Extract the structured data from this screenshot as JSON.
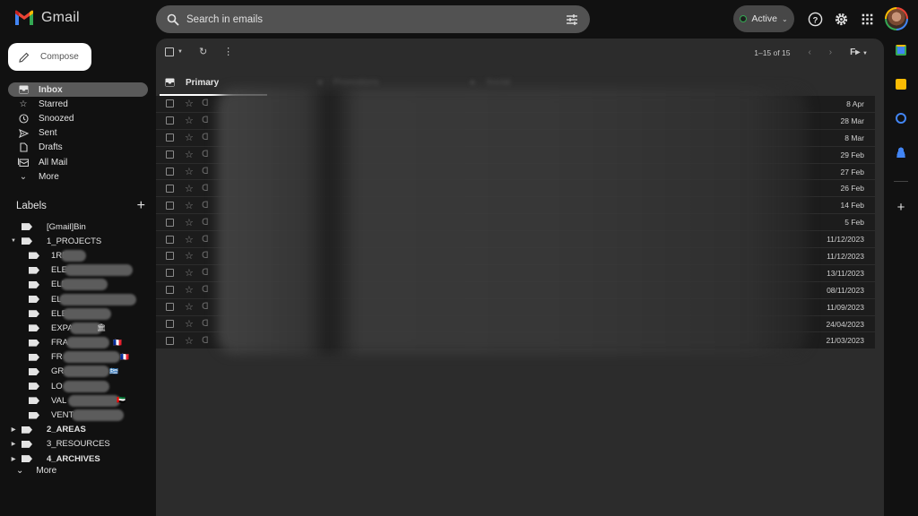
{
  "app": {
    "title": "Gmail",
    "brand_colors": {
      "red": "#ea4335",
      "blue": "#4285f4",
      "green": "#34a853",
      "yellow": "#fbbc04"
    }
  },
  "header": {
    "search_placeholder": "Search in emails",
    "status_label": "Active",
    "status_color": "#34a853",
    "icons": [
      "search-icon",
      "tune-icon",
      "help-icon",
      "settings-icon",
      "apps-grid-icon",
      "account-avatar"
    ]
  },
  "sidebar": {
    "compose_label": "Compose",
    "items": [
      {
        "label": "Inbox",
        "icon": "inbox-icon",
        "active": true
      },
      {
        "label": "Starred",
        "icon": "star-icon"
      },
      {
        "label": "Snoozed",
        "icon": "clock-icon"
      },
      {
        "label": "Sent",
        "icon": "send-icon"
      },
      {
        "label": "Drafts",
        "icon": "draft-icon"
      },
      {
        "label": "All Mail",
        "icon": "all-mail-icon"
      },
      {
        "label": "More",
        "icon": "chevron-down-icon"
      }
    ],
    "labels_title": "Labels",
    "labels": [
      {
        "label": "[Gmail]Bin",
        "level": "top-plain"
      },
      {
        "label": "1_PROJECTS",
        "level": "top",
        "expanded": true
      },
      {
        "label": "1RE",
        "level": "child",
        "redacted": true
      },
      {
        "label": "ELE E",
        "level": "child",
        "redacted": true
      },
      {
        "label": "ELE",
        "level": "child",
        "redacted": true
      },
      {
        "label": "ELE",
        "level": "child",
        "redacted": true
      },
      {
        "label": "ELE",
        "level": "child",
        "redacted": true
      },
      {
        "label": "EXPA",
        "level": "child",
        "redacted": true,
        "emoji": "🏛"
      },
      {
        "label": "FRA",
        "level": "child",
        "redacted": true,
        "emoji": "🇫🇷"
      },
      {
        "label": "FR",
        "level": "child",
        "redacted": true,
        "emoji": "🇫🇷"
      },
      {
        "label": "GR",
        "level": "child",
        "redacted": true,
        "emoji": "🇬🇷"
      },
      {
        "label": "LO",
        "level": "child",
        "redacted": true
      },
      {
        "label": "VAL",
        "level": "child",
        "redacted": true,
        "emoji": "🇦🇪"
      },
      {
        "label": "VENT",
        "level": "child",
        "redacted": true
      },
      {
        "label": "2_AREAS",
        "level": "top",
        "bold": true
      },
      {
        "label": "3_RESOURCES",
        "level": "top"
      },
      {
        "label": "4_ARCHIVES",
        "level": "top",
        "bold": true
      }
    ],
    "more_label": "More"
  },
  "main": {
    "pagination": "1–15 of 15",
    "format_label": "F",
    "tabs": [
      {
        "label": "Primary",
        "active": true
      },
      {
        "label": "Promotions",
        "blurred": true
      },
      {
        "label": "Social",
        "blurred": true
      }
    ],
    "emails": [
      {
        "date": "8 Apr"
      },
      {
        "date": "28 Mar"
      },
      {
        "date": "8 Mar"
      },
      {
        "date": "29 Feb"
      },
      {
        "date": "27 Feb"
      },
      {
        "date": "26 Feb"
      },
      {
        "date": "14 Feb"
      },
      {
        "date": "5 Feb"
      },
      {
        "date": "11/12/2023"
      },
      {
        "date": "11/12/2023"
      },
      {
        "date": "13/11/2023"
      },
      {
        "date": "08/11/2023"
      },
      {
        "date": "11/09/2023"
      },
      {
        "date": "24/04/2023"
      },
      {
        "date": "21/03/2023"
      }
    ],
    "content_blurred": true
  },
  "right_rail": {
    "apps": [
      {
        "name": "calendar",
        "color": "#4285f4"
      },
      {
        "name": "keep",
        "color": "#fbbc04"
      },
      {
        "name": "tasks",
        "color": "#4285f4"
      },
      {
        "name": "contacts",
        "color": "#4285f4"
      }
    ],
    "add_label": "+"
  }
}
